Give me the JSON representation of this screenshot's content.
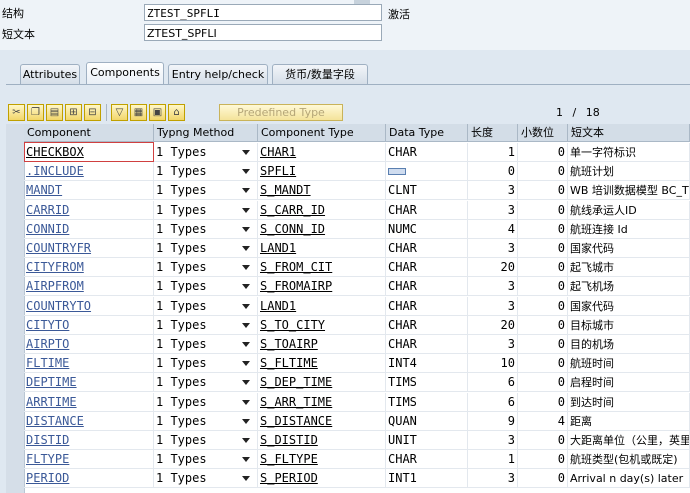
{
  "header": {
    "structure_label": "结构",
    "structure_value": "ZTEST_SPFLI",
    "status": "激活",
    "short_text_label": "短文本",
    "short_text_value": "ZTEST_SPFLI"
  },
  "tabs": [
    {
      "label": "Attributes"
    },
    {
      "label": "Components"
    },
    {
      "label": "Entry help/check"
    },
    {
      "label": "货币/数量字段"
    }
  ],
  "toolbar": {
    "predefined_type_label": "Predefined Type",
    "page_current": "1",
    "page_sep": "/",
    "page_total": "18",
    "icons": [
      "cut-icon",
      "copy-icon",
      "paste-icon",
      "insert-row-icon",
      "delete-row-icon",
      "sort-icon",
      "details-icon",
      "structure-icon",
      "hierarchy-icon"
    ]
  },
  "columns": {
    "component": "Component",
    "typing_method": "Typng Method",
    "component_type": "Component Type",
    "data_type": "Data Type",
    "length": "长度",
    "decimals": "小数位",
    "short_text": "短文本"
  },
  "rows": [
    {
      "component": "CHECKBOX",
      "typing": "1 Types",
      "ctype": "CHAR1",
      "dtype": "CHAR",
      "len": "1",
      "dec": "0",
      "short": "单一字符标识"
    },
    {
      "component": ".INCLUDE",
      "typing": "1 Types",
      "ctype": "SPFLI",
      "dtype": "",
      "len": "0",
      "dec": "0",
      "short": "航班计划"
    },
    {
      "component": "MANDT",
      "typing": "1 Types",
      "ctype": "S_MANDT",
      "dtype": "CLNT",
      "len": "3",
      "dec": "0",
      "short": "WB 培训数据模型 BC_T"
    },
    {
      "component": "CARRID",
      "typing": "1 Types",
      "ctype": "S_CARR_ID",
      "dtype": "CHAR",
      "len": "3",
      "dec": "0",
      "short": "航线承运人ID"
    },
    {
      "component": "CONNID",
      "typing": "1 Types",
      "ctype": "S_CONN_ID",
      "dtype": "NUMC",
      "len": "4",
      "dec": "0",
      "short": "航班连接 Id"
    },
    {
      "component": "COUNTRYFR",
      "typing": "1 Types",
      "ctype": "LAND1",
      "dtype": "CHAR",
      "len": "3",
      "dec": "0",
      "short": "国家代码"
    },
    {
      "component": "CITYFROM",
      "typing": "1 Types",
      "ctype": "S_FROM_CIT",
      "dtype": "CHAR",
      "len": "20",
      "dec": "0",
      "short": "起飞城市"
    },
    {
      "component": "AIRPFROM",
      "typing": "1 Types",
      "ctype": "S_FROMAIRP",
      "dtype": "CHAR",
      "len": "3",
      "dec": "0",
      "short": "起飞机场"
    },
    {
      "component": "COUNTRYTO",
      "typing": "1 Types",
      "ctype": "LAND1",
      "dtype": "CHAR",
      "len": "3",
      "dec": "0",
      "short": "国家代码"
    },
    {
      "component": "CITYTO",
      "typing": "1 Types",
      "ctype": "S_TO_CITY",
      "dtype": "CHAR",
      "len": "20",
      "dec": "0",
      "short": "目标城市"
    },
    {
      "component": "AIRPTO",
      "typing": "1 Types",
      "ctype": "S_TOAIRP",
      "dtype": "CHAR",
      "len": "3",
      "dec": "0",
      "short": "目的机场"
    },
    {
      "component": "FLTIME",
      "typing": "1 Types",
      "ctype": "S_FLTIME",
      "dtype": "INT4",
      "len": "10",
      "dec": "0",
      "short": "航班时间"
    },
    {
      "component": "DEPTIME",
      "typing": "1 Types",
      "ctype": "S_DEP_TIME",
      "dtype": "TIMS",
      "len": "6",
      "dec": "0",
      "short": "启程时间"
    },
    {
      "component": "ARRTIME",
      "typing": "1 Types",
      "ctype": "S_ARR_TIME",
      "dtype": "TIMS",
      "len": "6",
      "dec": "0",
      "short": "到达时间"
    },
    {
      "component": "DISTANCE",
      "typing": "1 Types",
      "ctype": "S_DISTANCE",
      "dtype": "QUAN",
      "len": "9",
      "dec": "4",
      "short": "距离"
    },
    {
      "component": "DISTID",
      "typing": "1 Types",
      "ctype": "S_DISTID",
      "dtype": "UNIT",
      "len": "3",
      "dec": "0",
      "short": "大距离单位（公里，英里"
    },
    {
      "component": "FLTYPE",
      "typing": "1 Types",
      "ctype": "S_FLTYPE",
      "dtype": "CHAR",
      "len": "1",
      "dec": "0",
      "short": "航班类型(包机或既定)"
    },
    {
      "component": "PERIOD",
      "typing": "1 Types",
      "ctype": "S_PERIOD",
      "dtype": "INT1",
      "len": "3",
      "dec": "0",
      "short": "Arrival n day(s) later"
    }
  ]
}
